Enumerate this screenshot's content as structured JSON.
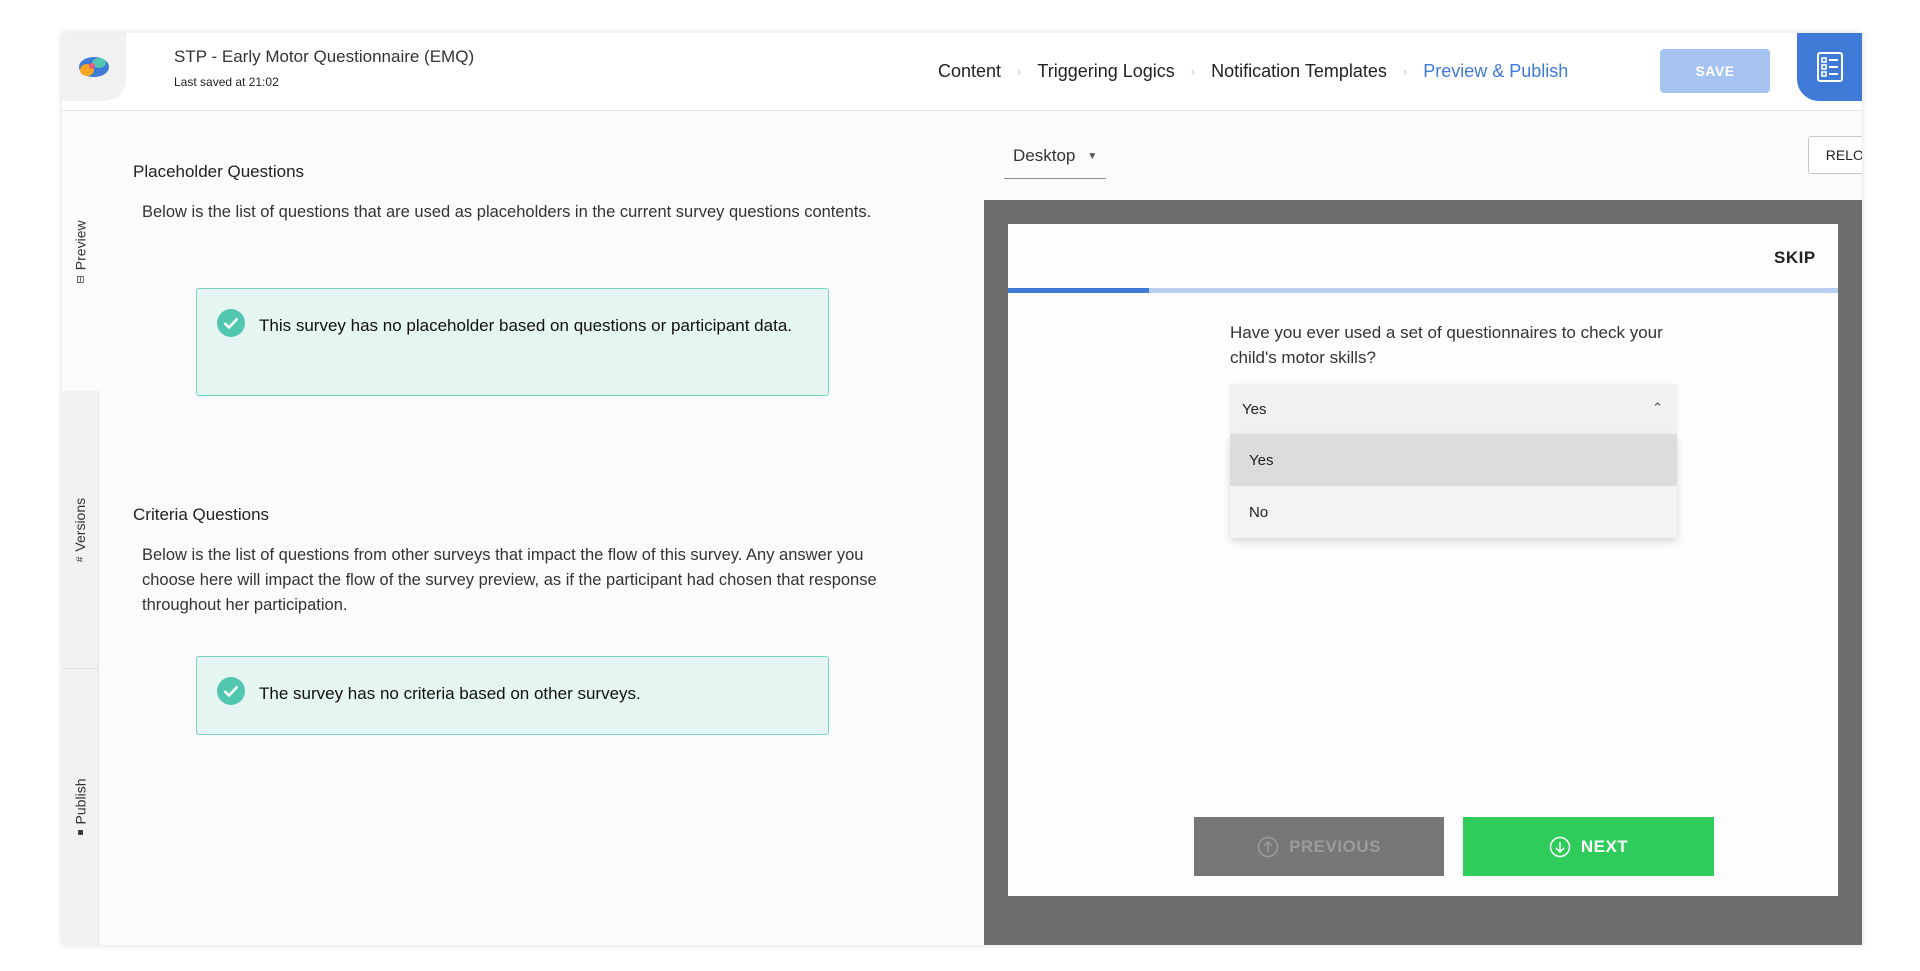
{
  "header": {
    "title": "STP - Early Motor Questionnaire (EMQ)",
    "last_saved": "Last saved at 21:02",
    "steps": [
      {
        "label": "Content",
        "active": false
      },
      {
        "label": "Triggering Logics",
        "active": false
      },
      {
        "label": "Notification Templates",
        "active": false
      },
      {
        "label": "Preview & Publish",
        "active": true
      }
    ],
    "save_label": "SAVE",
    "accent_color": "#3e7ad6"
  },
  "side_tabs": [
    {
      "label": "Preview",
      "icon": "preview-icon",
      "active": true
    },
    {
      "label": "Versions",
      "icon": "hash-icon",
      "active": false
    },
    {
      "label": "Publish",
      "icon": "publish-icon",
      "active": false
    }
  ],
  "left": {
    "placeholder": {
      "title": "Placeholder Questions",
      "description": "Below is the list of questions that are used as placeholders in the current survey questions contents.",
      "message": "This survey has no placeholder based on questions or participant data."
    },
    "criteria": {
      "title": "Criteria Questions",
      "description": "Below is the list of questions from other surveys that impact the flow of this survey. Any answer you choose here will impact the flow of the survey preview, as if the participant had chosen that response throughout her participation.",
      "message": "The survey has no criteria based on other surveys."
    },
    "success_color": "#52c7b0"
  },
  "preview": {
    "device": "Desktop",
    "reload_label": "RELOAD",
    "skip_label": "SKIP",
    "progress": 0.17,
    "question": "Have you ever used a set of questionnaires to check your child's motor skills?",
    "selected_value": "Yes",
    "options": [
      "Yes",
      "No"
    ],
    "previous_label": "PREVIOUS",
    "next_label": "NEXT",
    "next_color": "#2fcc5c"
  }
}
